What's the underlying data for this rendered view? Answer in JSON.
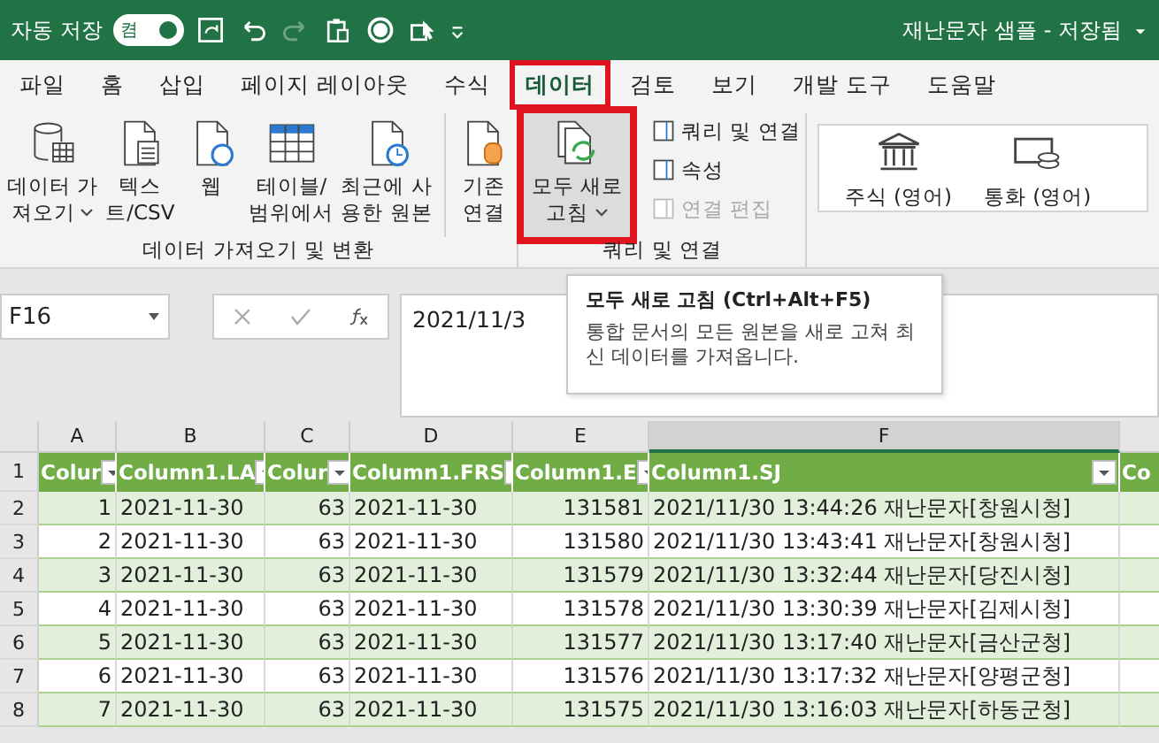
{
  "title_bar": {
    "autosave_label": "자동 저장",
    "autosave": {
      "on": true,
      "label": "켬"
    },
    "document_title": "재난문자 샘플 - 저장됨"
  },
  "tabs": [
    {
      "label": "파일",
      "selected": false,
      "highlighted": false
    },
    {
      "label": "홈",
      "selected": false,
      "highlighted": false
    },
    {
      "label": "삽입",
      "selected": false,
      "highlighted": false
    },
    {
      "label": "페이지 레이아웃",
      "selected": false,
      "highlighted": false
    },
    {
      "label": "수식",
      "selected": false,
      "highlighted": false
    },
    {
      "label": "데이터",
      "selected": true,
      "highlighted": true
    },
    {
      "label": "검토",
      "selected": false,
      "highlighted": false
    },
    {
      "label": "보기",
      "selected": false,
      "highlighted": false
    },
    {
      "label": "개발 도구",
      "selected": false,
      "highlighted": false
    },
    {
      "label": "도움말",
      "selected": false,
      "highlighted": false
    }
  ],
  "ribbon": {
    "get_data_group": {
      "label": "데이터 가져오기 및 변환",
      "buttons": [
        {
          "lines": [
            "데이터 가",
            "져오기"
          ],
          "dropdown": true
        },
        {
          "lines": [
            "텍스",
            "트/CSV"
          ],
          "dropdown": false
        },
        {
          "lines": [
            "웹"
          ],
          "dropdown": false
        },
        {
          "lines": [
            "테이블/",
            "범위에서"
          ],
          "dropdown": false
        },
        {
          "lines": [
            "최근에 사",
            "용한 원본"
          ],
          "dropdown": false
        },
        {
          "lines": [
            "기존",
            "연결"
          ],
          "dropdown": false
        }
      ]
    },
    "queries_group": {
      "label": "쿼리 및 연결",
      "refresh": {
        "lines": [
          "모두 새로",
          "고침"
        ],
        "dropdown": true,
        "highlighted": true
      },
      "small_buttons": [
        {
          "label": "쿼리 및 연결",
          "disabled": false
        },
        {
          "label": "속성",
          "disabled": false
        },
        {
          "label": "연결 편집",
          "disabled": true
        }
      ]
    },
    "data_types": [
      {
        "label": "주식 (영어)"
      },
      {
        "label": "통화 (영어)"
      }
    ]
  },
  "formula_bar": {
    "name_box": "F16",
    "formula": "2021/11/3"
  },
  "tooltip": {
    "title": "모두 새로 고침 (Ctrl+Alt+F5)",
    "body": "통합 문서의 모든 원본을 새로 고쳐 최신 데이터를 가져옵니다."
  },
  "sheet": {
    "columns": [
      {
        "letter": "A",
        "selected": false
      },
      {
        "letter": "B",
        "selected": false
      },
      {
        "letter": "C",
        "selected": false
      },
      {
        "letter": "D",
        "selected": false
      },
      {
        "letter": "E",
        "selected": false
      },
      {
        "letter": "F",
        "selected": true
      }
    ],
    "header": {
      "row": "1",
      "cells": [
        "Colur",
        "Column1.LA",
        "Colur",
        "Column1.FRS",
        "Column1.E",
        "Column1.SJ",
        "Co"
      ]
    },
    "rows": [
      {
        "row": "2",
        "cells": [
          "1",
          "2021-11-30",
          "63",
          "2021-11-30",
          "131581",
          "2021/11/30 13:44:26 재난문자[창원시청]"
        ]
      },
      {
        "row": "3",
        "cells": [
          "2",
          "2021-11-30",
          "63",
          "2021-11-30",
          "131580",
          "2021/11/30 13:43:41 재난문자[창원시청]"
        ]
      },
      {
        "row": "4",
        "cells": [
          "3",
          "2021-11-30",
          "63",
          "2021-11-30",
          "131579",
          "2021/11/30 13:32:44 재난문자[당진시청]"
        ]
      },
      {
        "row": "5",
        "cells": [
          "4",
          "2021-11-30",
          "63",
          "2021-11-30",
          "131578",
          "2021/11/30 13:30:39 재난문자[김제시청]"
        ]
      },
      {
        "row": "6",
        "cells": [
          "5",
          "2021-11-30",
          "63",
          "2021-11-30",
          "131577",
          "2021/11/30 13:17:40 재난문자[금산군청]"
        ]
      },
      {
        "row": "7",
        "cells": [
          "6",
          "2021-11-30",
          "63",
          "2021-11-30",
          "131576",
          "2021/11/30 13:17:32 재난문자[양평군청]"
        ]
      },
      {
        "row": "8",
        "cells": [
          "7",
          "2021-11-30",
          "63",
          "2021-11-30",
          "131575",
          "2021/11/30 13:16:03 재난문자[하동군청]"
        ]
      }
    ]
  }
}
